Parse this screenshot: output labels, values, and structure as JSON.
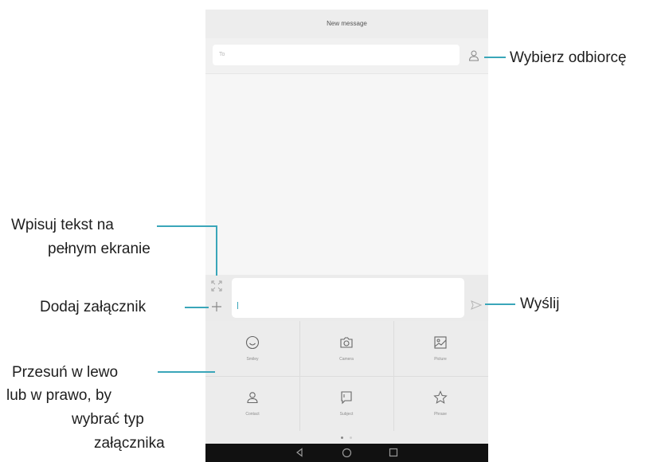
{
  "screen": {
    "title": "New message",
    "to_placeholder": "To",
    "attachments": [
      {
        "label": "Smiley",
        "icon": "smiley-icon"
      },
      {
        "label": "Camera",
        "icon": "camera-icon"
      },
      {
        "label": "Picture",
        "icon": "picture-icon"
      },
      {
        "label": "Contact",
        "icon": "contact-icon"
      },
      {
        "label": "Subject",
        "icon": "subject-icon"
      },
      {
        "label": "Phrase",
        "icon": "star-icon"
      }
    ],
    "pager": {
      "pages": 2,
      "current": 1
    },
    "nav_icons": [
      "back-icon",
      "home-icon",
      "recents-icon"
    ]
  },
  "callouts": {
    "recipient": "Wybierz odbiorcę",
    "fullscreen_line1": "Wpisuj tekst na",
    "fullscreen_line2": "pełnym ekranie",
    "attach": "Dodaj załącznik",
    "send": "Wyślij",
    "swipe_line1": "Przesuń w lewo",
    "swipe_line2": "lub w prawo, by",
    "swipe_line3": "wybrać typ",
    "swipe_line4": "załącznika"
  },
  "colors": {
    "accent": "#3aa6b9",
    "navbar": "#111111",
    "panel": "#ececec"
  }
}
